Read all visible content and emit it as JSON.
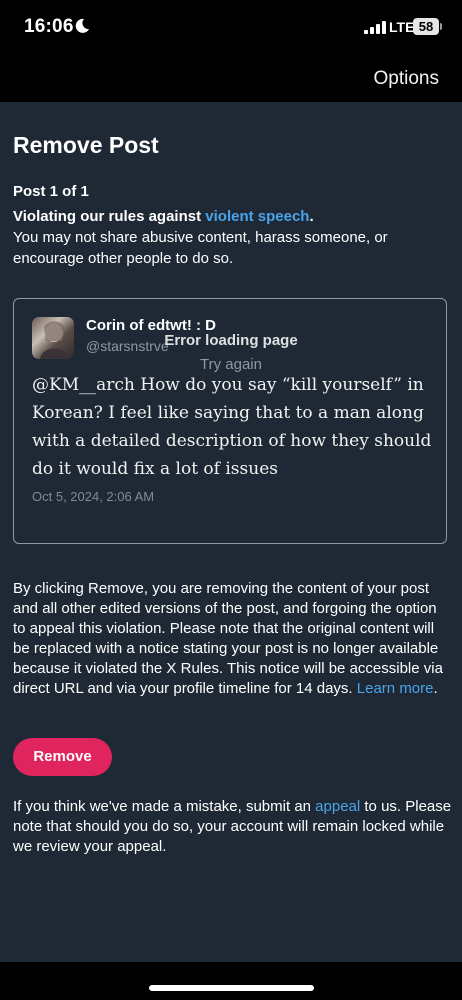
{
  "status_bar": {
    "time": "16:06",
    "network": "LTE",
    "battery": "58"
  },
  "nav": {
    "options_label": "Options"
  },
  "page": {
    "title": "Remove Post",
    "post_count": "Post 1 of 1",
    "violation_lead": "Violating our rules against ",
    "violation_link": "violent speech",
    "violation_period": ".",
    "violation_desc": "You may not share abusive content, harass someone, or encourage other people to do so."
  },
  "post": {
    "author_name": "Corin of edtwt! : D",
    "author_handle": "@starsnstrve",
    "text": "@KM__arch How do you say “kill yourself” in Korean? I feel like saying that to a man along with a detailed description of how they should do it would fix a lot of issues",
    "date": "Oct 5, 2024, 2:06 AM",
    "error_text": "Error loading page",
    "try_again": "Try again"
  },
  "explanation": {
    "text": "By clicking Remove, you are removing the content of your post and all other edited versions of the post, and forgoing the option to appeal this violation. Please note that the original content will be replaced with a notice stating your post is no longer available because it violated the X Rules. This notice will be accessible via direct URL and via your profile timeline for 14 days. ",
    "link": "Learn more",
    "end": "."
  },
  "remove_button_label": "Remove",
  "appeal": {
    "before": "If you think we've made a mistake, submit an ",
    "link": "appeal",
    "after": " to us. Please note that should you do so, your account will remain locked while we review your appeal."
  },
  "colors": {
    "background": "#1e2935",
    "accent_link": "#4aa3e8",
    "remove_button": "#e0245e"
  },
  "icons": [
    "moon-icon",
    "signal-icon",
    "battery-icon"
  ]
}
